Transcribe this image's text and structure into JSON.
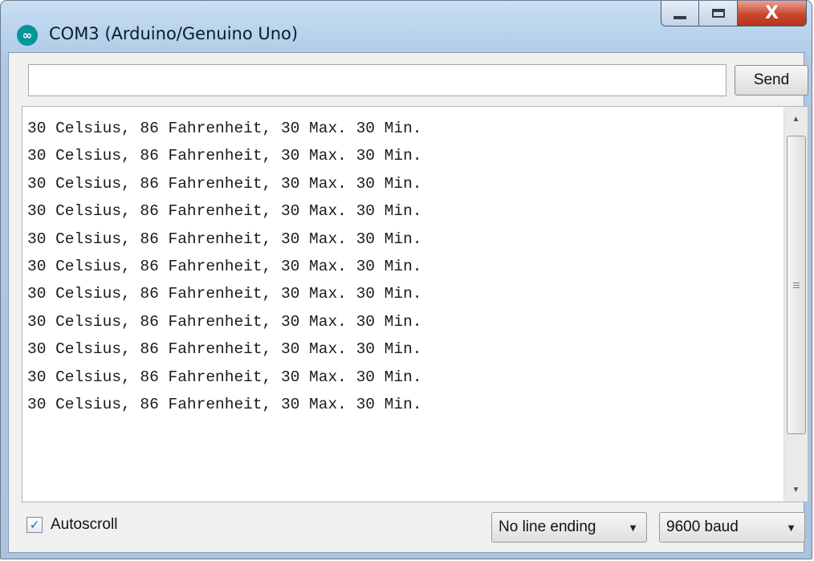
{
  "window": {
    "title": "COM3 (Arduino/Genuino Uno)",
    "app_icon_glyph": "∞",
    "accent": "#00979c",
    "close_glyph": "X"
  },
  "send": {
    "input_value": "",
    "input_placeholder": "",
    "button_label": "Send"
  },
  "output": {
    "lines": [
      "30 Celsius, 86 Fahrenheit, 30 Max. 30 Min.",
      "30 Celsius, 86 Fahrenheit, 30 Max. 30 Min.",
      "30 Celsius, 86 Fahrenheit, 30 Max. 30 Min.",
      "30 Celsius, 86 Fahrenheit, 30 Max. 30 Min.",
      "30 Celsius, 86 Fahrenheit, 30 Max. 30 Min.",
      "30 Celsius, 86 Fahrenheit, 30 Max. 30 Min.",
      "30 Celsius, 86 Fahrenheit, 30 Max. 30 Min.",
      "30 Celsius, 86 Fahrenheit, 30 Max. 30 Min.",
      "30 Celsius, 86 Fahrenheit, 30 Max. 30 Min.",
      "30 Celsius, 86 Fahrenheit, 30 Max. 30 Min.",
      "30 Celsius, 86 Fahrenheit, 30 Max. 30 Min."
    ]
  },
  "footer": {
    "autoscroll_label": "Autoscroll",
    "autoscroll_checked": true,
    "line_ending": "No line ending",
    "baud_rate": "9600 baud"
  },
  "icons": {
    "app": "arduino-logo-icon",
    "minimize": "minimize-icon",
    "maximize": "maximize-icon",
    "close": "close-icon",
    "scroll_up": "arrow-up-icon",
    "scroll_down": "arrow-down-icon",
    "dropdown": "chevron-down-icon"
  }
}
